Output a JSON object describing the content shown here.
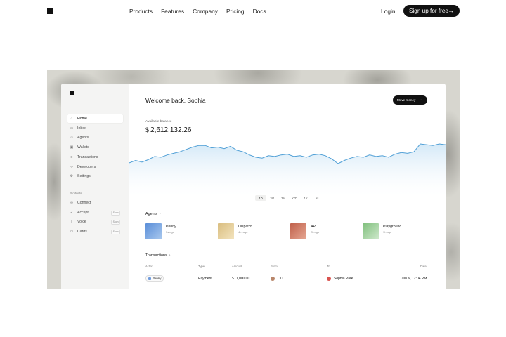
{
  "nav": {
    "links": [
      "Products",
      "Features",
      "Company",
      "Pricing",
      "Docs"
    ],
    "login": "Login",
    "signup": "Sign up for free",
    "signup_arrow": "→"
  },
  "app": {
    "sidebar": {
      "items": [
        {
          "label": "Home",
          "icon": "home-icon",
          "active": true
        },
        {
          "label": "Inbox",
          "icon": "inbox-icon"
        },
        {
          "label": "Agents",
          "icon": "agents-icon"
        },
        {
          "label": "Wallets",
          "icon": "wallet-icon"
        },
        {
          "label": "Transactions",
          "icon": "list-icon"
        },
        {
          "label": "Developers",
          "icon": "code-icon"
        },
        {
          "label": "Settings",
          "icon": "gear-icon"
        }
      ],
      "products_label": "Products",
      "products": [
        {
          "label": "Connect",
          "icon": "link-icon",
          "soon": ""
        },
        {
          "label": "Accept",
          "icon": "check-icon",
          "soon": "Soon"
        },
        {
          "label": "Voice",
          "icon": "phone-icon",
          "soon": "Soon"
        },
        {
          "label": "Cards",
          "icon": "card-icon",
          "soon": "Soon"
        }
      ]
    },
    "welcome": "Welcome back, Sophia",
    "move_money": "Move money",
    "move_chevron": "⌄",
    "balance_label": "Available balance",
    "balance_currency": "$",
    "balance_value": "2,612,132.26",
    "ranges": [
      "1D",
      "1M",
      "3M",
      "YTD",
      "1Y",
      "All"
    ],
    "selected_range": "1D",
    "agents_title": "Agents",
    "agents": [
      {
        "name": "Penny",
        "ago": "3s ago",
        "colors": [
          "#5a8ed8",
          "#a9c8ee"
        ]
      },
      {
        "name": "Dispatch",
        "ago": "4m ago",
        "colors": [
          "#d9bd7f",
          "#f3e4bf"
        ]
      },
      {
        "name": "AP",
        "ago": "2h ago",
        "colors": [
          "#c0604a",
          "#e6a894"
        ]
      },
      {
        "name": "Playground",
        "ago": "9h ago",
        "colors": [
          "#7fbf7c",
          "#cfe9cc"
        ]
      }
    ],
    "transactions_title": "Transactions",
    "tx_headers": {
      "actor": "Actor",
      "type": "Type",
      "amount": "Amount",
      "from": "From",
      "to": "To",
      "date": "Date"
    },
    "tx_row": {
      "actor": "Penny",
      "type": "Payment",
      "amount_currency": "$",
      "amount": "1,000.00",
      "from": "CLI",
      "to": "Sophia Park",
      "date": "Jun 6, 12:04 PM"
    },
    "accent_color": "#111111",
    "chart_line_color": "#4f9fd6"
  },
  "chart_data": {
    "type": "area",
    "title": "",
    "xlabel": "",
    "ylabel": "",
    "values": [
      30,
      33,
      31,
      34,
      38,
      37,
      40,
      42,
      44,
      47,
      50,
      52,
      52,
      49,
      50,
      48,
      51,
      46,
      44,
      40,
      37,
      36,
      39,
      38,
      40,
      41,
      38,
      39,
      37,
      40,
      41,
      39,
      35,
      29,
      33,
      36,
      38,
      37,
      40,
      38,
      39,
      37,
      41,
      43,
      42,
      44,
      54,
      53,
      52,
      54,
      53
    ]
  }
}
